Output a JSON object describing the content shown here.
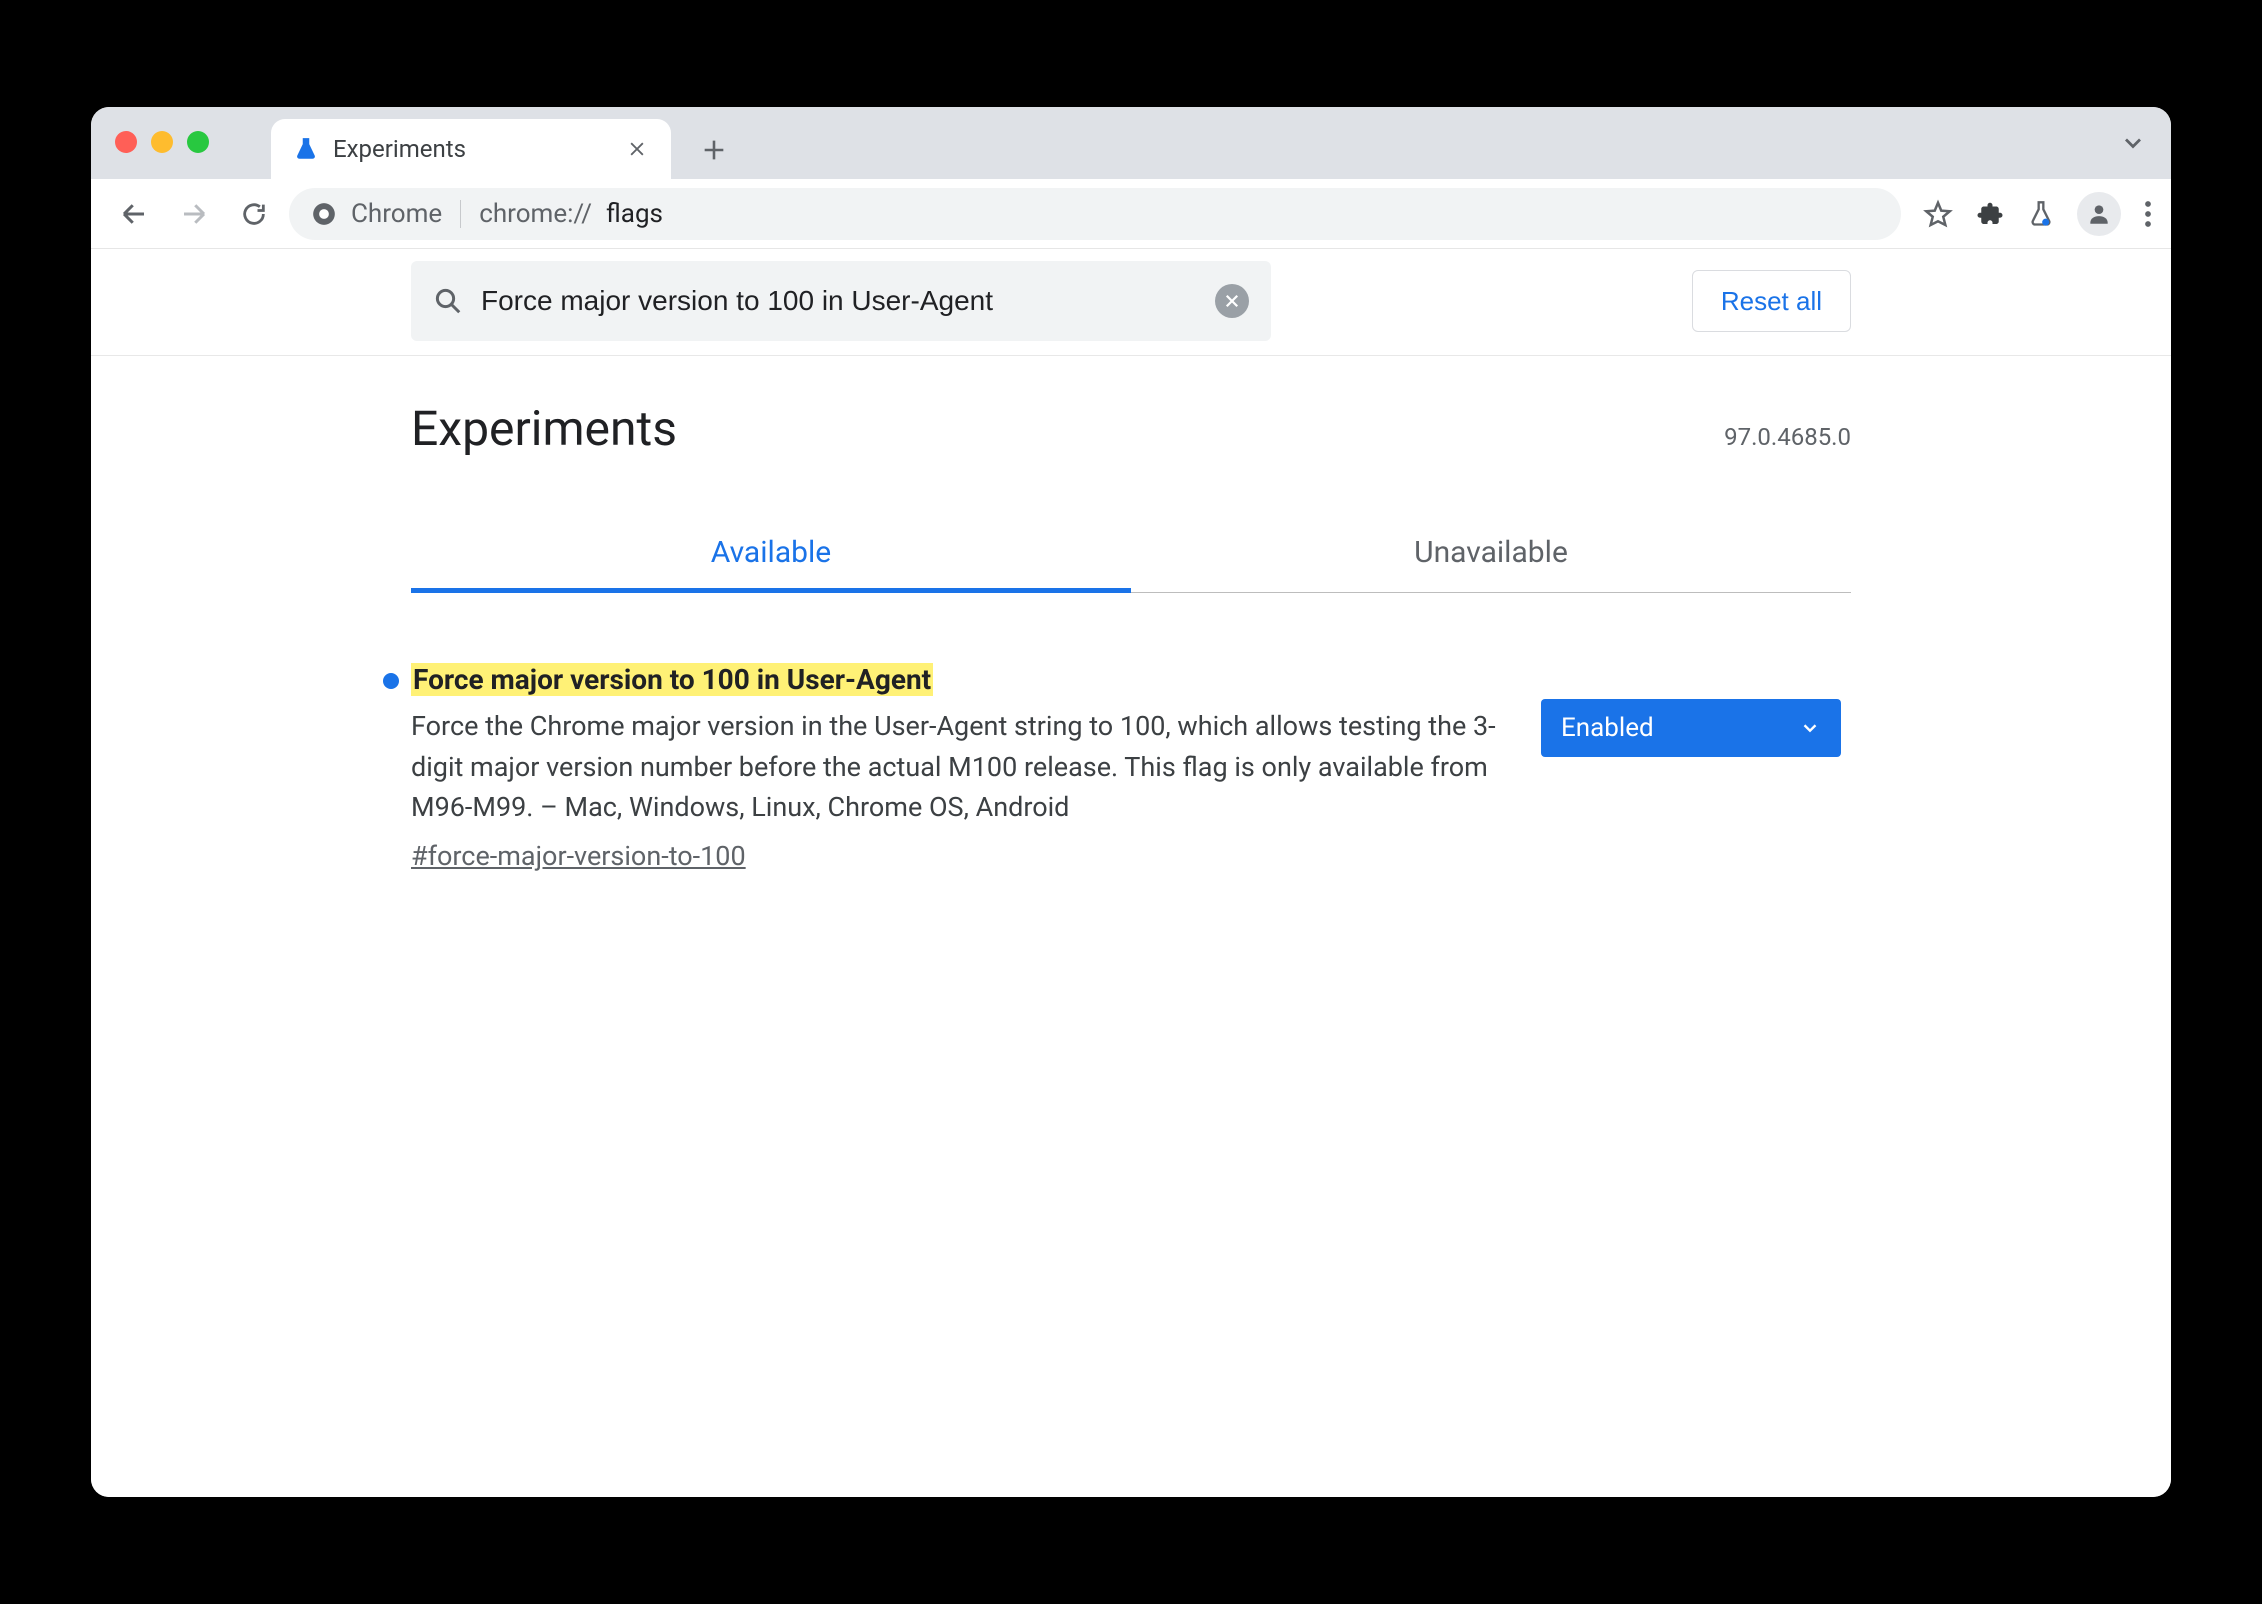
{
  "browser": {
    "tab_title": "Experiments",
    "omnibox": {
      "chip_label": "Chrome",
      "url_prefix": "chrome://",
      "url_path": "flags"
    }
  },
  "flags_page": {
    "search_value": "Force major version to 100 in User-Agent",
    "reset_label": "Reset all",
    "title": "Experiments",
    "version": "97.0.4685.0",
    "tabs": [
      {
        "label": "Available",
        "active": true
      },
      {
        "label": "Unavailable",
        "active": false
      }
    ],
    "flag": {
      "title": "Force major version to 100 in User-Agent",
      "description": "Force the Chrome major version in the User-Agent string to 100, which allows testing the 3-digit major version number before the actual M100 release. This flag is only available from M96-M99. – Mac, Windows, Linux, Chrome OS, Android",
      "hash": "#force-major-version-to-100",
      "selected": "Enabled"
    }
  }
}
